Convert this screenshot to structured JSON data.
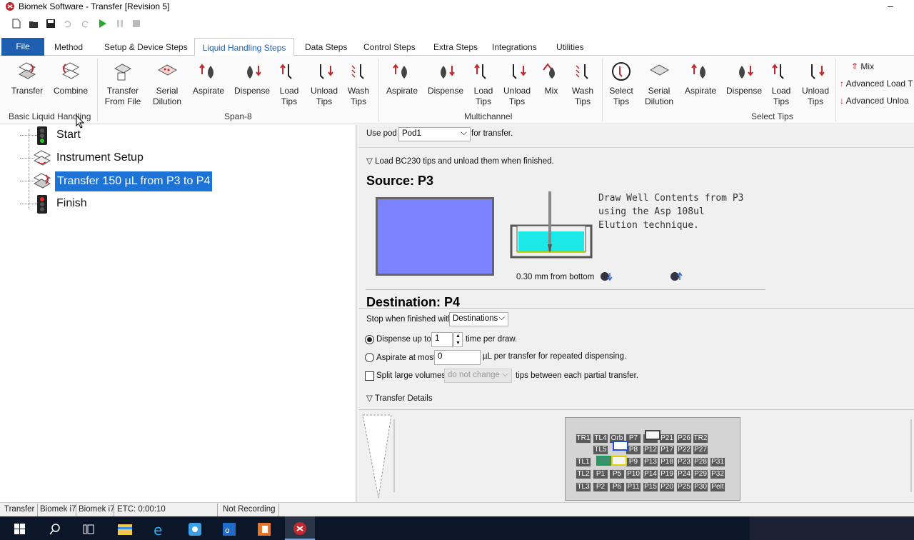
{
  "window": {
    "title": "Biomek Software - Transfer [Revision 5]",
    "minimize": "–"
  },
  "tabs": [
    "File",
    "Method",
    "Setup & Device Steps",
    "Liquid Handling Steps",
    "Data Steps",
    "Control Steps",
    "Extra Steps",
    "Integrations",
    "Utilities"
  ],
  "ribbon": {
    "basic": {
      "label": "Basic Liquid Handling",
      "items": [
        "Transfer",
        "Combine"
      ]
    },
    "span8": {
      "label": "Span-8",
      "items": [
        "Transfer From File",
        "Serial Dilution",
        "Aspirate",
        "Dispense",
        "Load Tips",
        "Unload Tips",
        "Wash Tips"
      ]
    },
    "multichannel": {
      "label": "Multichannel",
      "items": [
        "Aspirate",
        "Dispense",
        "Load Tips",
        "Unload Tips",
        "Mix",
        "Wash Tips"
      ]
    },
    "select_tips": {
      "label": "Select Tips",
      "items": [
        "Select Tips",
        "Serial Dilution",
        "Aspirate",
        "Dispense",
        "Load Tips",
        "Unload Tips"
      ]
    },
    "extra": [
      "Mix",
      "Advanced Load T",
      "Advanced Unloa"
    ]
  },
  "tree": {
    "start": "Start",
    "setup": "Instrument Setup",
    "transfer": "Transfer 150 µL from P3 to P4",
    "finish": "Finish"
  },
  "panel": {
    "use_pod_pre": "Use pod",
    "pod": "Pod1",
    "use_pod_post": "for transfer.",
    "load_tips": "Load BC230 tips and unload them when finished.",
    "source_title": "Source: P3",
    "desc_line1": "Draw Well Contents from P3",
    "desc_line2": "using the Asp 108ul",
    "desc_line3": "Elution technique.",
    "height": "0.30 mm from bottom",
    "dest_title": "Destination: P4",
    "stop_label": "Stop when finished with",
    "stop_value": "Destinations",
    "dispense_label": "Dispense up to",
    "dispense_value": "1",
    "dispense_post": "time per draw.",
    "aspirate_label": "Aspirate at most",
    "aspirate_value": "0",
    "aspirate_post": "µL per transfer for repeated dispensing.",
    "split_label": "Split large volumes,",
    "split_value": "do not change",
    "split_post": "tips between each partial transfer.",
    "details": "Transfer Details"
  },
  "deck": [
    "TR1",
    "TL4",
    "Orb",
    "P7",
    "P16",
    "P21",
    "P26",
    "TR2",
    "TL5",
    "P8",
    "P12",
    "P17",
    "P22",
    "P27",
    "TL1",
    "P9",
    "P13",
    "P18",
    "P23",
    "P28",
    "P31",
    "TL2",
    "P1",
    "P5",
    "P10",
    "P14",
    "P19",
    "P24",
    "P29",
    "P32",
    "TL3",
    "P2",
    "P6",
    "P11",
    "P15",
    "P20",
    "P25",
    "P30",
    "Pelt"
  ],
  "status": {
    "step": "Transfer",
    "inst1": "Biomek i7",
    "inst2": "Biomek i7",
    "etc": "ETC: 0:00:10",
    "rec": "Not Recording"
  }
}
